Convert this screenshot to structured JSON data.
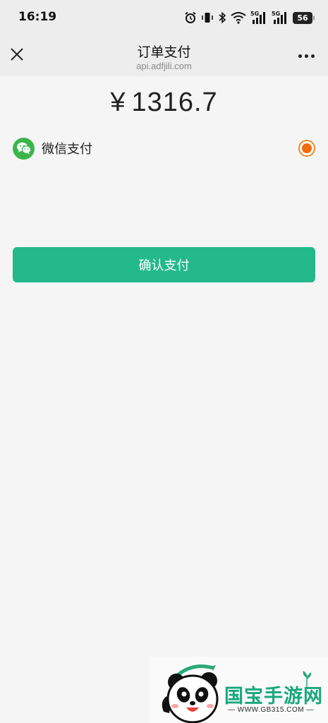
{
  "status_bar": {
    "time": "16:19",
    "net_label_1": "5G",
    "net_label_2": "5G",
    "battery": "56",
    "icons": [
      "alarm-icon",
      "vibrate-icon",
      "bluetooth-icon",
      "wifi-icon",
      "signal-icon",
      "signal-icon",
      "battery-icon"
    ]
  },
  "nav": {
    "title": "订单支付",
    "subtitle": "api.adfjili.com",
    "close_icon": "close-icon",
    "more_icon": "more-icon"
  },
  "payment": {
    "currency": "¥",
    "amount": "1316.7",
    "method_label": "微信支付",
    "method_icon": "wechat-icon",
    "selected": true
  },
  "confirm_button": {
    "label": "确认支付",
    "color": "#24b98a"
  },
  "watermark": {
    "brand": "国宝手游网",
    "url": "WWW.GB315.COM"
  },
  "colors": {
    "background": "#f5f5f5",
    "header": "#ededed",
    "accent": "#24b98a",
    "radio": "#f26a0c",
    "wechat": "#3bb54a"
  }
}
